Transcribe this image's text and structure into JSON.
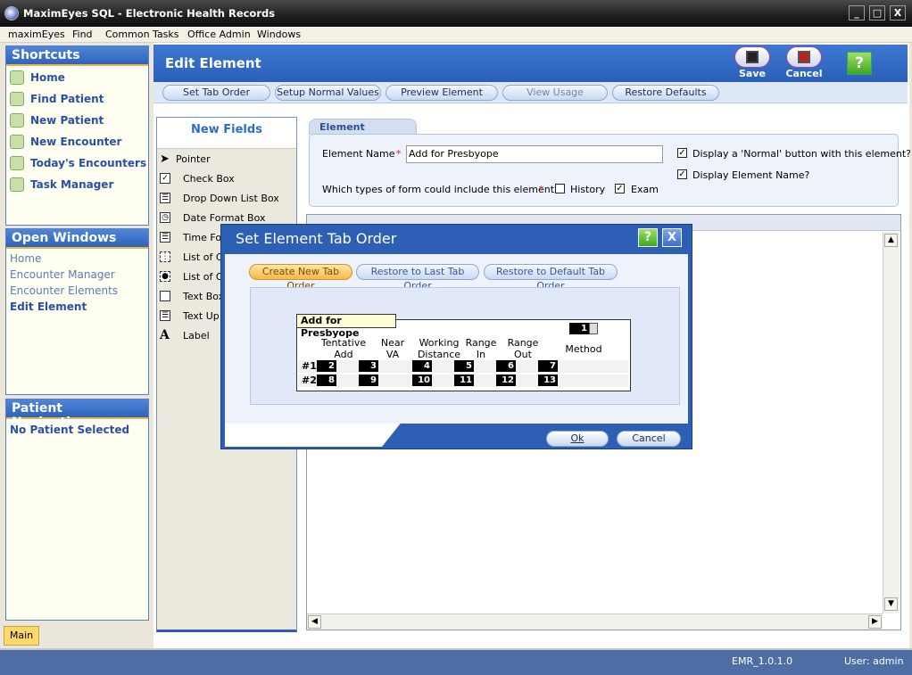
{
  "app": {
    "title": "MaximEyes SQL - Electronic Health Records"
  },
  "window_controls": {
    "minimize": "_",
    "maximize": "□",
    "close": "X"
  },
  "menu": [
    "maximEyes",
    "Find",
    "Common Tasks",
    "Office Admin",
    "Windows"
  ],
  "shortcuts": {
    "title": "Shortcuts",
    "items": [
      "Home",
      "Find Patient",
      "New Patient",
      "New Encounter",
      "Today's Encounters",
      "Task Manager"
    ]
  },
  "open_windows": {
    "title": "Open Windows",
    "items": [
      "Home",
      "Encounter Manager",
      "Encounter Elements",
      "Edit Element"
    ],
    "active": "Edit Element"
  },
  "patient_nav": {
    "title": "Patient Navigation",
    "status": "No Patient Selected"
  },
  "bottom_tab": "Main",
  "header": {
    "title": "Edit Element",
    "save": "Save",
    "cancel": "Cancel",
    "help": "?"
  },
  "toolbar": [
    "Set Tab Order",
    "Setup Normal Values",
    "Preview Element",
    "View Usage",
    "Restore Defaults"
  ],
  "new_fields": {
    "title": "New Fields",
    "items": [
      "Pointer",
      "Check Box",
      "Drop Down List Box",
      "Date Format Box",
      "Time For",
      "List of Ch",
      "List of Op",
      "Text Box",
      "Text Up",
      "Label"
    ]
  },
  "details": {
    "tab": "Element Details",
    "name_label": "Element Name",
    "required": "*",
    "name_value": "Add for Presbyope",
    "display_normal": "Display a 'Normal' button with this element?",
    "display_name": "Display Element Name?",
    "types_question": "Which types of form could include this element?",
    "history": "History",
    "exam": "Exam"
  },
  "dialog": {
    "title": "Set Element Tab Order",
    "help": "?",
    "close": "X",
    "actions": [
      "Create New Tab Order",
      "Restore to Last Tab Order",
      "Restore to Default Tab Order"
    ],
    "element_title": "Add for Presbyope",
    "method_tab": "1",
    "headers": [
      {
        "l1": "Tentative",
        "l2": "Add"
      },
      {
        "l1": "Near",
        "l2": "VA"
      },
      {
        "l1": "Working",
        "l2": "Distance"
      },
      {
        "l1": "Range",
        "l2": "In"
      },
      {
        "l1": "Range",
        "l2": "Out"
      },
      {
        "l1": "",
        "l2": "Method"
      }
    ],
    "rows": [
      {
        "label": "#1",
        "tabs": [
          "2",
          "3",
          "4",
          "5",
          "6",
          "7"
        ]
      },
      {
        "label": "#2",
        "tabs": [
          "8",
          "9",
          "10",
          "11",
          "12",
          "13"
        ]
      }
    ],
    "ok": "Ok",
    "cancel": "Cancel"
  },
  "status": {
    "version": "EMR_1.0.1.0",
    "user": "User: admin"
  }
}
